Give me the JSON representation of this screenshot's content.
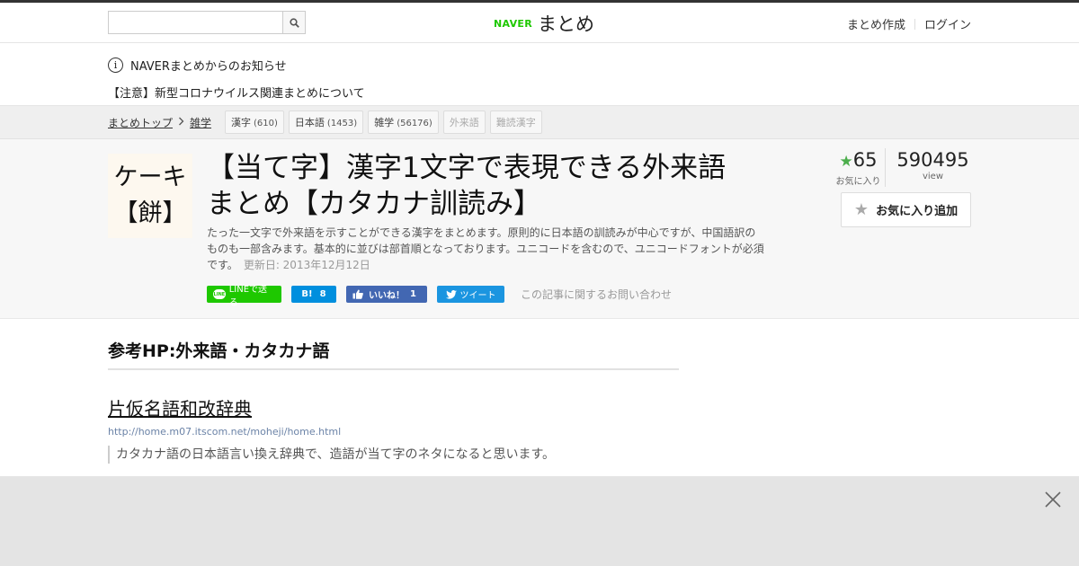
{
  "header": {
    "search": {
      "placeholder": "",
      "value": ""
    },
    "logo_brand": "NAVER",
    "logo_text": "まとめ",
    "links": [
      "まとめ作成",
      "ログイン"
    ]
  },
  "notice": {
    "title": "NAVERまとめからのお知らせ",
    "item": "【注意】新型コロナウイルス関連まとめについて"
  },
  "breadcrumb": {
    "items": [
      "まとめトップ",
      "雑学"
    ],
    "tags": [
      {
        "label": "漢字",
        "count": "(610)"
      },
      {
        "label": "日本語",
        "count": "(1453)"
      },
      {
        "label": "雑学",
        "count": "(56176)"
      },
      {
        "label": "外来語",
        "count": ""
      },
      {
        "label": "難読漢字",
        "count": ""
      }
    ]
  },
  "article": {
    "thumb_line1": "ケーキ",
    "thumb_line2": "【餅】",
    "title_line1": "【当て字】漢字1文字で表現できる外来語",
    "title_line2": "まとめ【カタカナ訓読み】",
    "description": "たった一文字で外来語を示すことができる漢字をまとめます。原則的に日本語の訓読みが中心ですが、中国語訳のものも一部含みます。基本的に並びは部首順となっております。ユニコードを含むので、ユニコードフォントが必須です。",
    "updated": "更新日: 2013年12月12日",
    "share": {
      "line": "LINEで送る",
      "hatena_label": "B!",
      "hatena_count": "8",
      "fb_label": "いいね！",
      "fb_count": "1",
      "tweet": "ツイート",
      "contact": "この記事に関するお問い合わせ"
    },
    "stats": {
      "favorites": "65",
      "favorites_label": "お気に入り",
      "views": "590495",
      "views_label": "view"
    },
    "fav_button": "お気に入り追加"
  },
  "content": {
    "heading": "参考HP:外来語・カタカナ語",
    "link_title": "片仮名語和改辞典",
    "link_url": "http://home.m07.itscom.net/moheji/home.html",
    "quote": "カタカナ語の日本語言い換え辞典で、造語が当て字のネタになると思います。"
  },
  "colors": {
    "brand_green": "#1ec800",
    "star_green": "#4cae4c",
    "hatena_blue": "#008fde",
    "facebook_blue": "#4267b2",
    "twitter_blue": "#1b95e0"
  },
  "icons": [
    "search-icon",
    "info-icon",
    "chevron-right-icon",
    "star-icon",
    "line-icon",
    "thumbs-up-icon",
    "twitter-bird-icon",
    "close-icon"
  ]
}
